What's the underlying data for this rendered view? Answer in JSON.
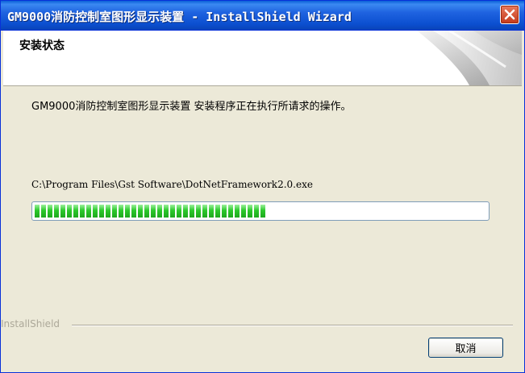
{
  "window": {
    "title": "GM9000消防控制室图形显示装置 - InstallShield Wizard"
  },
  "header": {
    "title": "安装状态"
  },
  "main": {
    "status_text": "GM9000消防控制室图形显示装置 安装程序正在执行所请求的操作。",
    "current_file": "C:\\Program Files\\Gst Software\\DotNetFramework2.0.exe",
    "progress_fraction": 0.51
  },
  "footer": {
    "brand": "InstallShield",
    "cancel_label": "取消"
  },
  "colors": {
    "titlebar": "#0a5fd7",
    "dialog_bg": "#ece9d8",
    "progress_fill": "#2bc82b"
  },
  "icons": [
    "close-icon",
    "wizard-header-art"
  ]
}
